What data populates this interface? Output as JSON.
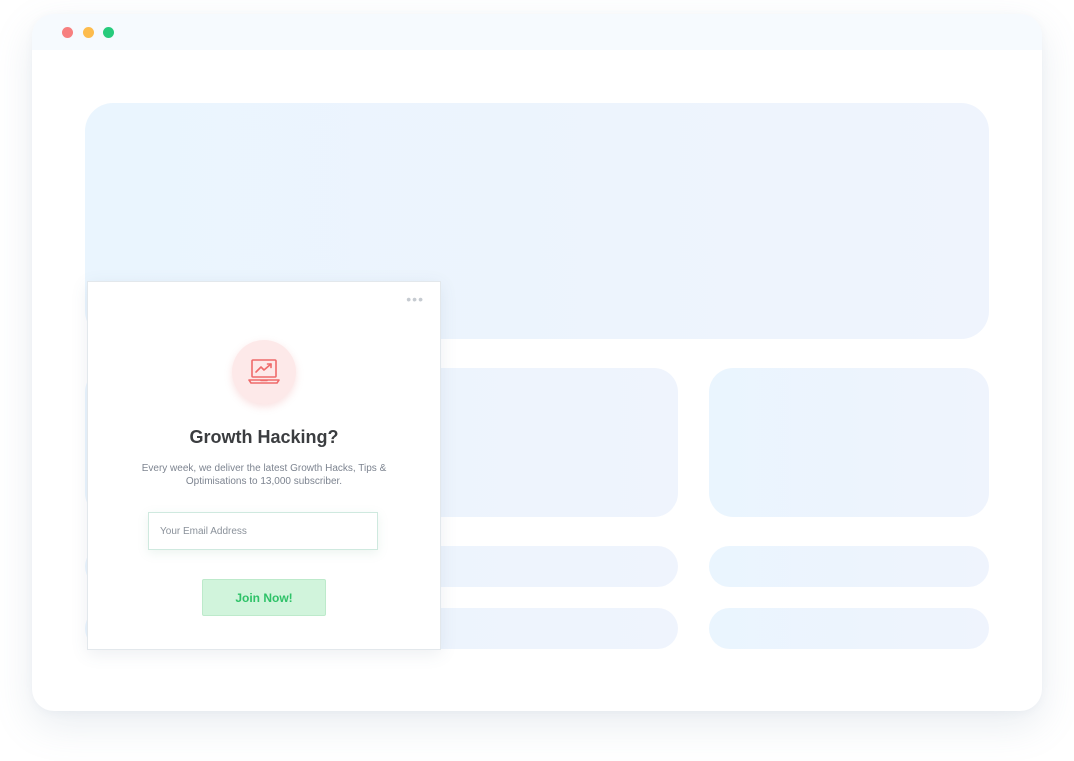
{
  "window": {
    "controls": [
      {
        "name": "close",
        "color": "#f77f7f"
      },
      {
        "name": "minimize",
        "color": "#fdbc4d"
      },
      {
        "name": "maximize",
        "color": "#27cb7c"
      }
    ]
  },
  "popup": {
    "menu_icon": "more-horizontal-icon",
    "menu_glyph": "•••",
    "icon": "laptop-growth-chart-icon",
    "icon_color": "#ef6a6a",
    "title": "Growth Hacking?",
    "description": "Every week, we deliver the latest Growth Hacks, Tips & Optimisations to 13,000 subscriber.",
    "email_placeholder": "Your Email Address",
    "email_value": "",
    "button_label": "Join Now!",
    "button_color": "#2ec268"
  }
}
